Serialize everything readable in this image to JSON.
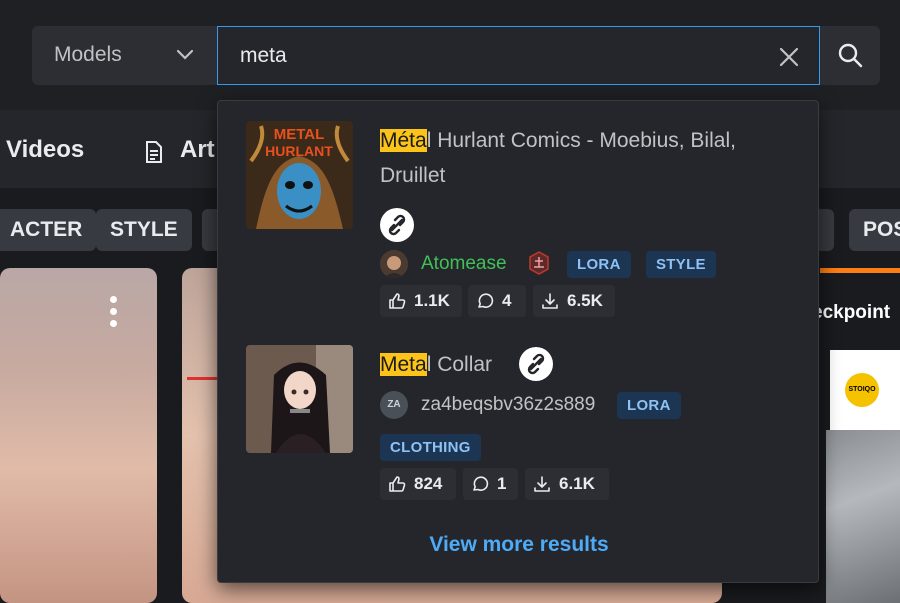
{
  "search": {
    "type_label": "Models",
    "query": "meta"
  },
  "nav": {
    "videos": "Videos",
    "articles": "Art"
  },
  "pills": [
    "ACTER",
    "STYLE",
    "POS"
  ],
  "checkpoint_label": "eckpoint",
  "stoiqo_logo": "STOIQO",
  "results": [
    {
      "title_highlight": "Méta",
      "title_rest_line1": "l Hurlant Comics - Moebius, Bilal,",
      "title_line2": "Druillet",
      "thumb_text": "METAL HURLANT",
      "user": "Atomease",
      "user_color": "#40c057",
      "badges": [
        "LORA",
        "STYLE"
      ],
      "likes": "1.1K",
      "comments": "4",
      "downloads": "6.5K"
    },
    {
      "title_highlight": "Meta",
      "title_rest_line1": "l Collar",
      "user": "za4beqsbv36z2s889",
      "user_initials": "ZA",
      "badges": [
        "LORA",
        "CLOTHING"
      ],
      "likes": "824",
      "comments": "1",
      "downloads": "6.1K"
    }
  ],
  "view_more": "View more results",
  "colors": {
    "accent": "#339af0",
    "highlight": "#fcc419",
    "link": "#4dabf7"
  }
}
